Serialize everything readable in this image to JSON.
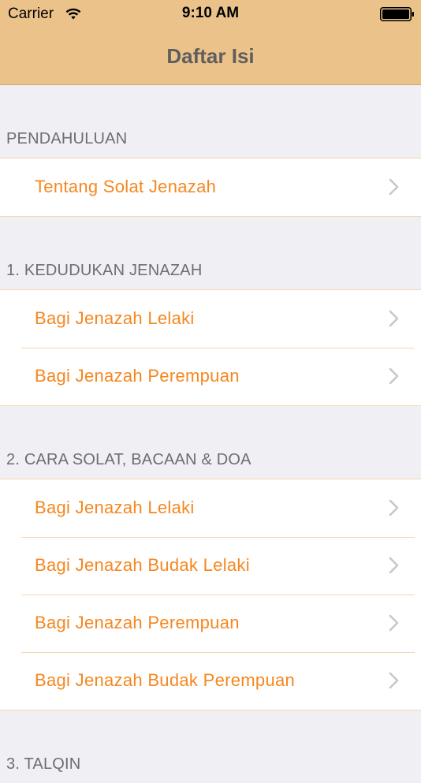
{
  "status_bar": {
    "carrier": "Carrier",
    "time": "9:10 AM",
    "wifi_icon": "wifi-icon",
    "battery_icon": "battery-icon"
  },
  "nav": {
    "title": "Daftar Isi",
    "background": "#ecc28b"
  },
  "colors": {
    "item_text": "#f5871f",
    "header_text": "#6d6d72",
    "background": "#efeff4"
  },
  "sections": [
    {
      "header": "PENDAHULUAN",
      "items": [
        {
          "label": "Tentang Solat Jenazah",
          "icon": "chevron-right-icon"
        }
      ]
    },
    {
      "header": "1. KEDUDUKAN JENAZAH",
      "items": [
        {
          "label": "Bagi Jenazah Lelaki",
          "icon": "chevron-right-icon"
        },
        {
          "label": "Bagi Jenazah Perempuan",
          "icon": "chevron-right-icon"
        }
      ]
    },
    {
      "header": "2. CARA SOLAT, BACAAN & DOA",
      "items": [
        {
          "label": "Bagi Jenazah Lelaki",
          "icon": "chevron-right-icon"
        },
        {
          "label": "Bagi Jenazah Budak Lelaki",
          "icon": "chevron-right-icon"
        },
        {
          "label": "Bagi Jenazah Perempuan",
          "icon": "chevron-right-icon"
        },
        {
          "label": "Bagi Jenazah Budak Perempuan",
          "icon": "chevron-right-icon"
        }
      ]
    },
    {
      "header": "3. TALQIN",
      "items": []
    }
  ]
}
